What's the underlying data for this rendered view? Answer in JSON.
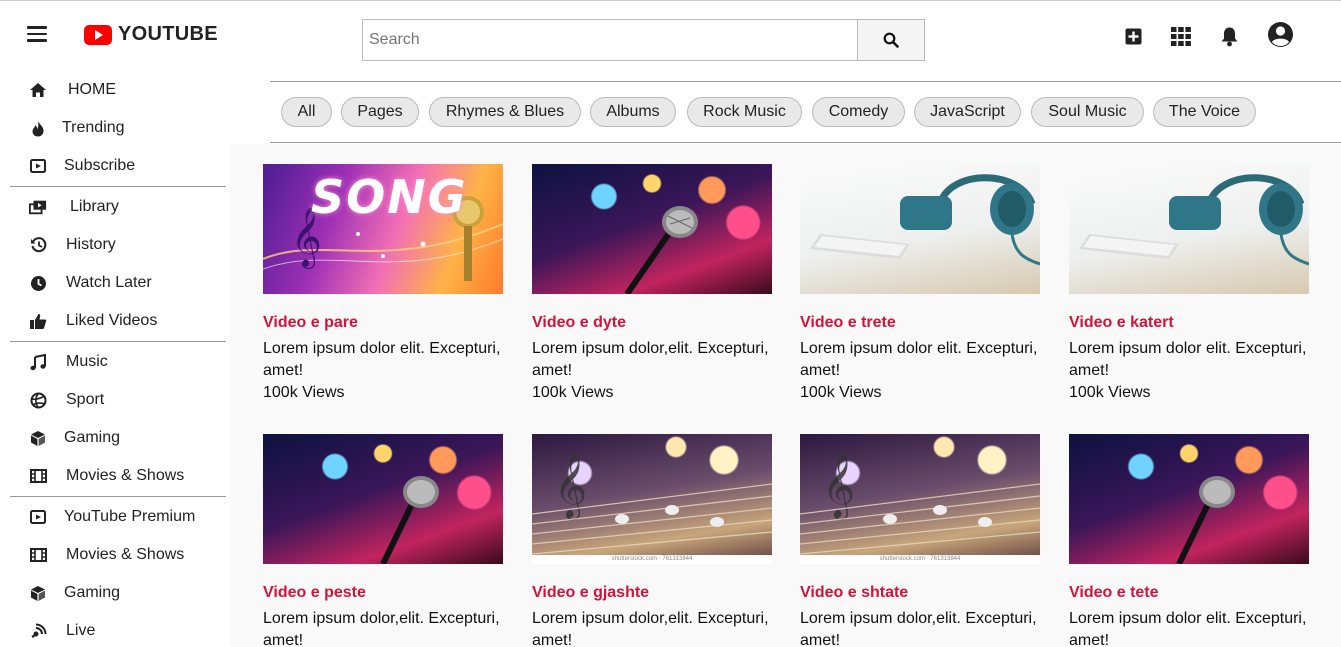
{
  "header": {
    "logo_text": "YOUTUBE",
    "search_placeholder": "Search",
    "icons": [
      "create-icon",
      "apps-icon",
      "notifications-icon",
      "account-icon"
    ]
  },
  "sidebar": {
    "groups": [
      [
        {
          "label": "HOME",
          "icon": "home-icon"
        },
        {
          "label": "Trending",
          "icon": "fire-icon"
        },
        {
          "label": "Subscribe",
          "icon": "subscriptions-icon"
        }
      ],
      [
        {
          "label": "Library",
          "icon": "library-icon"
        },
        {
          "label": "History",
          "icon": "history-icon"
        },
        {
          "label": "Watch Later",
          "icon": "clock-icon"
        },
        {
          "label": "Liked Videos",
          "icon": "thumbs-up-icon"
        }
      ],
      [
        {
          "label": "Music",
          "icon": "music-note-icon"
        },
        {
          "label": "Sport",
          "icon": "ball-icon"
        },
        {
          "label": "Gaming",
          "icon": "cube-icon"
        },
        {
          "label": "Movies & Shows",
          "icon": "film-icon"
        }
      ],
      [
        {
          "label": "YouTube Premium",
          "icon": "subscriptions-icon"
        },
        {
          "label": "Movies & Shows",
          "icon": "film-icon"
        },
        {
          "label": "Gaming",
          "icon": "cube-icon"
        },
        {
          "label": "Live",
          "icon": "live-icon"
        }
      ]
    ]
  },
  "chips": [
    "All",
    "Pages",
    "Rhymes & Blues",
    "Albums",
    "Rock Music",
    "Comedy",
    "JavaScript",
    "Soul Music",
    "The Voice"
  ],
  "videos": [
    {
      "title": "Video e pare",
      "desc": "Lorem ipsum dolor elit. Excepturi, amet!",
      "views": "100k Views",
      "thumb": "song"
    },
    {
      "title": "Video e dyte",
      "desc": "Lorem ipsum dolor,elit. Excepturi, amet!",
      "views": "100k Views",
      "thumb": "mic"
    },
    {
      "title": "Video e trete",
      "desc": "Lorem ipsum dolor elit. Excepturi, amet!",
      "views": "100k Views",
      "thumb": "phones"
    },
    {
      "title": "Video e katert",
      "desc": "Lorem ipsum dolor elit. Excepturi, amet!",
      "views": "100k Views",
      "thumb": "phones"
    },
    {
      "title": "Video e peste",
      "desc": "Lorem ipsum dolor,elit. Excepturi, amet!",
      "views": "",
      "thumb": "mic"
    },
    {
      "title": "Video e gjashte",
      "desc": "Lorem ipsum dolor,elit. Excepturi, amet!",
      "views": "",
      "thumb": "notes"
    },
    {
      "title": "Video e shtate",
      "desc": "Lorem ipsum dolor,elit. Excepturi, amet!",
      "views": "",
      "thumb": "notes"
    },
    {
      "title": "Video e tete",
      "desc": "Lorem ipsum dolor elit. Excepturi, amet!",
      "views": "",
      "thumb": "mic"
    }
  ],
  "thumb_text": {
    "song": "SONG",
    "watermark": "shutterstock.com · 761313844"
  },
  "colors": {
    "brand_red": "#ff0000",
    "title_red": "#d2143a",
    "chip_bg": "#e9e9e9",
    "content_bg": "#f9f9f9"
  }
}
